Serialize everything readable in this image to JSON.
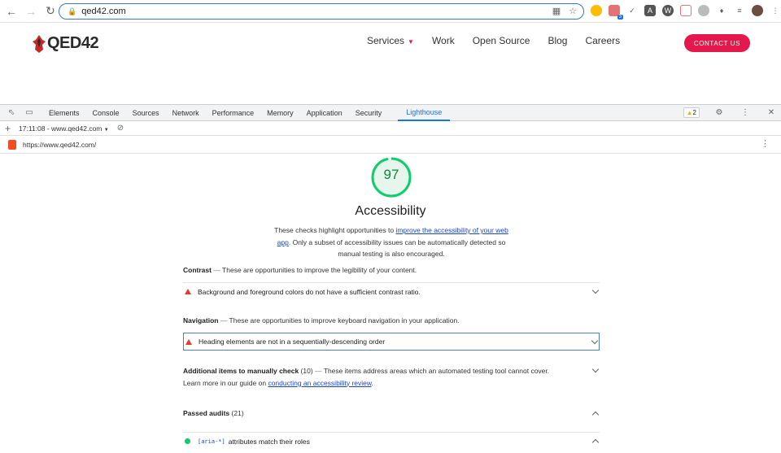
{
  "browser": {
    "url": "qed42.com",
    "extension_badge": "3"
  },
  "site": {
    "logo": "QED42",
    "nav": [
      {
        "label": "Services"
      },
      {
        "label": "Work"
      },
      {
        "label": "Open Source"
      },
      {
        "label": "Blog"
      },
      {
        "label": "Careers"
      }
    ],
    "contact_label": "CONTACT US",
    "brand_color": "#e5184e"
  },
  "devtools": {
    "tabs": [
      "Elements",
      "Console",
      "Sources",
      "Network",
      "Performance",
      "Memory",
      "Application",
      "Security",
      "Lighthouse"
    ],
    "active_tab": "Lighthouse",
    "warning_count": "2",
    "report_selector": "17:11:08 - www.qed42.com",
    "report_url": "https://www.qed42.com/"
  },
  "report": {
    "score": "97",
    "score_fraction": 0.97,
    "title": "Accessibility",
    "desc_pre": "These checks highlight opportunities to ",
    "desc_link": "improve the accessibility of your web app",
    "desc_post": ". Only a subset of accessibility issues can be automatically detected so manual testing is also encouraged.",
    "groups": {
      "contrast": {
        "title": "Contrast",
        "desc": "These are opportunities to improve the legibility of your content."
      },
      "navigation": {
        "title": "Navigation",
        "desc": "These are opportunities to improve keyboard navigation in your application."
      },
      "manual": {
        "title": "Additional items to manually check",
        "count": "(10)",
        "desc": "These items address areas which an automated testing tool cannot cover.",
        "learn_pre": "Learn more in our guide on ",
        "learn_link": "conducting an accessibility review",
        "learn_post": "."
      },
      "passed": {
        "title": "Passed audits",
        "count": "(21)"
      }
    },
    "audits": {
      "contrast": "Background and foreground colors do not have a sufficient contrast ratio.",
      "heading": "Heading elements are not in a sequentially-descending order",
      "aria_code": "[aria-*]",
      "aria_text": "attributes match their roles"
    }
  }
}
